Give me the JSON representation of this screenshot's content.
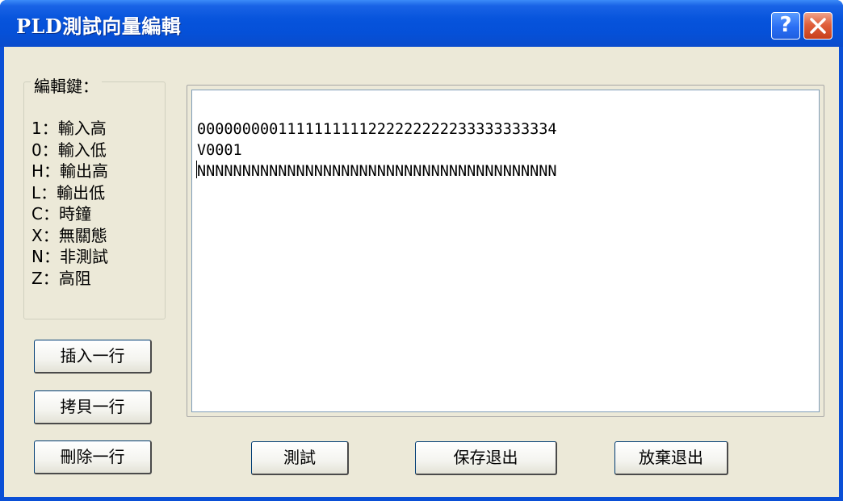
{
  "window": {
    "title": "PLD測試向量編輯",
    "help_symbol": "?",
    "close_label": "close"
  },
  "legend": {
    "title": "編輯鍵：",
    "items": [
      "1：輸入高",
      "0：輸入低",
      "H：輸出高",
      "L：輸出低",
      "C：時鐘",
      "X：無關態",
      "N：非測試",
      "Z：高阻"
    ]
  },
  "side_buttons": {
    "insert_line": "插入一行",
    "copy_line": "拷貝一行",
    "delete_line": "刪除一行"
  },
  "editor": {
    "lines": [
      "0000000001111111111222222222233333333334",
      "V0001",
      "NNNNNNNNNNNNNNNNNNNNNNNNNNNNNNNNNNNNNNNN"
    ]
  },
  "bottom_buttons": {
    "test": "測試",
    "save_exit": "保存退出",
    "abandon_exit": "放棄退出"
  },
  "colors": {
    "titlebar": "#0754dc",
    "dialog_bg": "#ece9d8",
    "close_button": "#e0603c",
    "editor_bg": "#ffffff"
  }
}
